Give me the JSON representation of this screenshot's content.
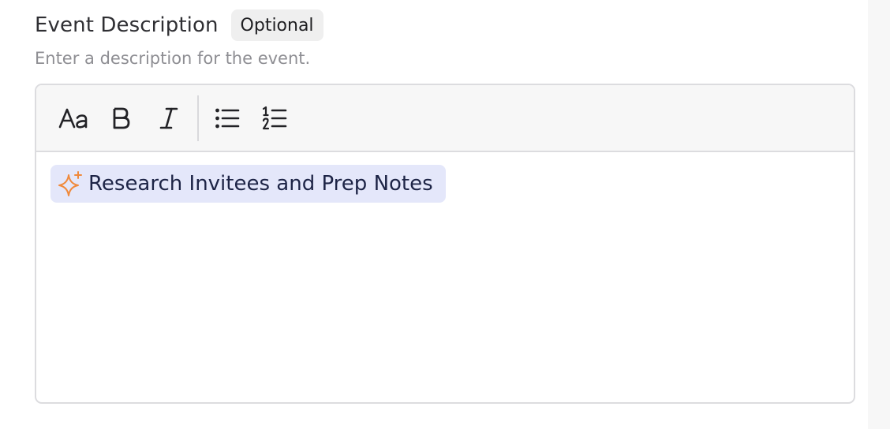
{
  "field": {
    "label": "Event Description",
    "badge": "Optional",
    "help_text": "Enter a description for the event."
  },
  "toolbar": {
    "buttons": [
      {
        "name": "text-style",
        "icon": "text-size-icon"
      },
      {
        "name": "bold",
        "icon": "bold-icon"
      },
      {
        "name": "italic",
        "icon": "italic-icon"
      },
      {
        "name": "bulleted-list",
        "icon": "bulleted-list-icon"
      },
      {
        "name": "numbered-list",
        "icon": "numbered-list-icon"
      }
    ]
  },
  "editor": {
    "suggestion_chip": {
      "icon": "sparkle-icon",
      "label": "Research Invitees and Prep Notes"
    }
  },
  "colors": {
    "chip_background": "#e4e7fa",
    "sparkle": "#f08a3c",
    "chip_text": "#1d2446"
  }
}
